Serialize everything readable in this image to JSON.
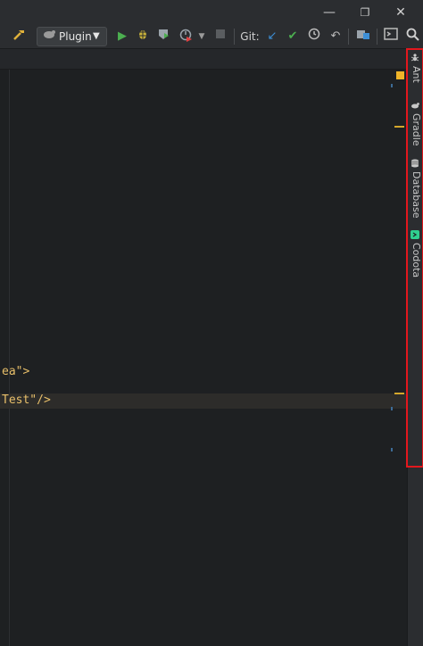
{
  "window": {
    "minimize_glyph": "—",
    "restore_glyph": "❐",
    "close_glyph": "✕"
  },
  "toolbar": {
    "run_config_label": "Plugin",
    "git_label": "Git:",
    "icons": [
      "build-icon",
      "run-config-icon",
      "run-icon",
      "debug-icon",
      "coverage-icon",
      "profile-icon",
      "stop-icon",
      "git-update-icon",
      "git-commit-icon",
      "history-icon",
      "rollback-icon",
      "project-structure-icon",
      "terminal-icon",
      "search-icon"
    ]
  },
  "editor": {
    "lines": [
      {
        "text": "ea\">"
      },
      {
        "text": "Test\"/>"
      }
    ]
  },
  "right_tool_windows": [
    {
      "label": "Ant",
      "icon": "ant-icon"
    },
    {
      "label": "Gradle",
      "icon": "gradle-icon"
    },
    {
      "label": "Database",
      "icon": "database-icon"
    },
    {
      "label": "Codota",
      "icon": "codota-icon"
    }
  ],
  "colors": {
    "highlight_border": "#e3171d",
    "accent_yellow": "#f0b429",
    "run_green": "#4caf50",
    "git_blue": "#3d8fd6"
  }
}
